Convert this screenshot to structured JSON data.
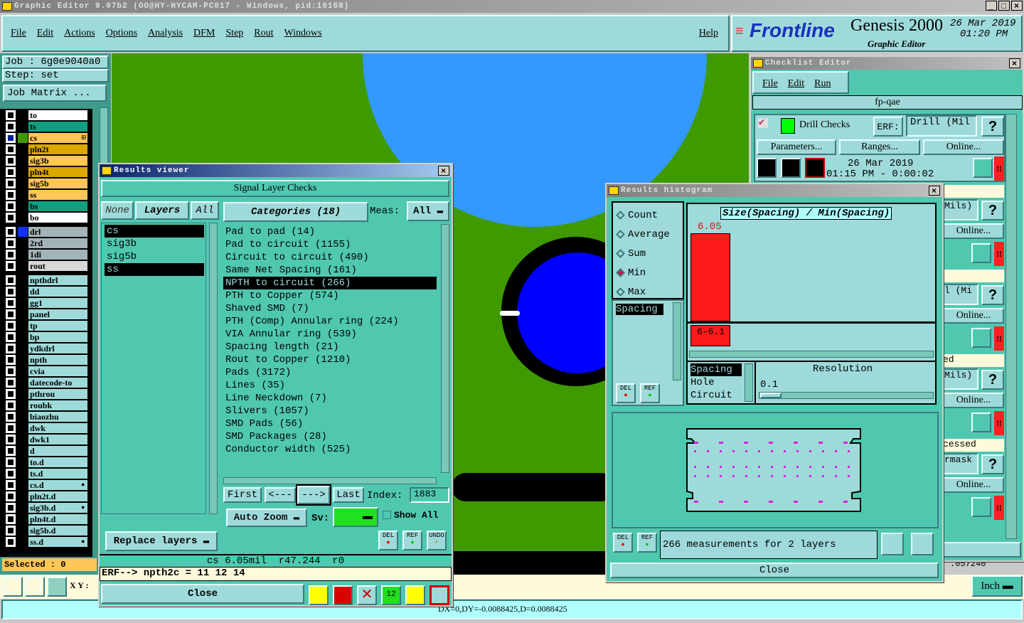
{
  "window_title": "Graphic Editor 9.07b2 (OO@HY-HYCAM-PC017 - Windows, pid:10168)",
  "menu": [
    "File",
    "Edit",
    "Actions",
    "Options",
    "Analysis",
    "DFM",
    "Step",
    "Rout",
    "Windows"
  ],
  "help": "Help",
  "brand": {
    "logo": "Frontline",
    "product": "Genesis 2000",
    "subtitle": "Graphic Editor",
    "date": "26 Mar 2019",
    "time": "01:20 PM"
  },
  "job": {
    "job_label": "Job : 6g0e9040a0",
    "step_label": "Step: set",
    "matrix_button": "Job Matrix ..."
  },
  "layers": [
    {
      "name": "to",
      "color": "#ffffff"
    },
    {
      "name": "ts",
      "color": "#10a080"
    },
    {
      "name": "cs",
      "color": "#ffc658",
      "active": true
    },
    {
      "name": "pln2t",
      "color": "#dba800"
    },
    {
      "name": "sig3b",
      "color": "#ffc658"
    },
    {
      "name": "pln4t",
      "color": "#dba800"
    },
    {
      "name": "sig5b",
      "color": "#ffc658"
    },
    {
      "name": "ss",
      "color": "#ffc658"
    },
    {
      "name": "bs",
      "color": "#10a080"
    },
    {
      "name": "bo",
      "color": "#ffffff"
    },
    {
      "name": "drl",
      "color": "#a3b4b8",
      "group": 2
    },
    {
      "name": "2rd",
      "color": "#a3b4b8",
      "group": 2
    },
    {
      "name": "1di",
      "color": "#a3b4b8",
      "group": 2
    },
    {
      "name": "rout",
      "color": "#d8d8d8",
      "group": 2
    },
    {
      "name": "npthdrl",
      "group": 3
    },
    {
      "name": "dd",
      "group": 3
    },
    {
      "name": "gg1",
      "group": 3
    },
    {
      "name": "panel",
      "group": 3
    },
    {
      "name": "tp",
      "group": 3
    },
    {
      "name": "bp",
      "group": 3
    },
    {
      "name": "ydkdrl",
      "group": 3
    },
    {
      "name": "npth",
      "group": 3
    },
    {
      "name": "cvia",
      "group": 3
    },
    {
      "name": "datecode-to",
      "group": 3
    },
    {
      "name": "pthrou",
      "group": 3
    },
    {
      "name": "roubk",
      "group": 3
    },
    {
      "name": "biaozhu",
      "group": 3
    },
    {
      "name": "dwk",
      "group": 3
    },
    {
      "name": "dwk1",
      "group": 3
    },
    {
      "name": "d",
      "group": 3
    },
    {
      "name": "to.d",
      "group": 3
    },
    {
      "name": "ts.d",
      "group": 3
    },
    {
      "name": "cs.d",
      "group": 3,
      "mark": true
    },
    {
      "name": "pln2t.d",
      "group": 3
    },
    {
      "name": "sig3b.d",
      "group": 3,
      "mark": true
    },
    {
      "name": "pln4t.d",
      "group": 3
    },
    {
      "name": "sig5b.d",
      "group": 3
    },
    {
      "name": "ss.d",
      "group": 3,
      "mark": true
    }
  ],
  "selected_label": "Selected : 0",
  "xy_label": "X Y :",
  "status_line": "DX=0,DY=-0.0088425,D=0.0088425",
  "units": "Inch",
  "coord_readout": ".057240",
  "results_viewer": {
    "title": "Results viewer",
    "header": "Signal Layer Checks",
    "none": "None",
    "layers_label": "Layers",
    "all": "All",
    "layers": [
      {
        "name": "cs",
        "selected": true
      },
      {
        "name": "sig3b"
      },
      {
        "name": "sig5b"
      },
      {
        "name": "ss",
        "selected": true
      }
    ],
    "categories_label": "Categories (18)",
    "meas_label": "Meas:",
    "meas_value": "All",
    "categories": [
      {
        "t": "Pad to pad (14)"
      },
      {
        "t": "Pad to circuit (1155)"
      },
      {
        "t": "Circuit to circuit (490)"
      },
      {
        "t": "Same Net Spacing (161)"
      },
      {
        "t": "NPTH to circuit (266)",
        "selected": true
      },
      {
        "t": "PTH to Copper (574)"
      },
      {
        "t": "Shaved SMD (7)"
      },
      {
        "t": "PTH (Comp) Annular ring (224)"
      },
      {
        "t": "VIA Annular ring (539)"
      },
      {
        "t": "Spacing length (21)"
      },
      {
        "t": "Rout to Copper (1210)"
      },
      {
        "t": "Pads (3172)"
      },
      {
        "t": "Lines (35)"
      },
      {
        "t": "Line Neckdown (7)"
      },
      {
        "t": "Slivers (1057)"
      },
      {
        "t": "SMD Pads (56)"
      },
      {
        "t": "SMD Packages (28)"
      },
      {
        "t": "Conductor width (525)"
      }
    ],
    "first": "First",
    "prev": "<---",
    "next": "--->",
    "last": "Last",
    "index_label": "Index:",
    "index_value": "1883",
    "auto_zoom": "Auto Zoom",
    "sv_label": "Sv:",
    "show_all": "Show All",
    "replace_layers": "Replace layers",
    "del": "DEL",
    "ref": "REF",
    "undo": "UNDO",
    "info": "cs 6.05mil  r47.244  r0",
    "erf": "ERF--> npth2c = 11 12 14",
    "close": "Close"
  },
  "histogram": {
    "title": "Results histogram",
    "modes": [
      {
        "label": "Count"
      },
      {
        "label": "Average"
      },
      {
        "label": "Sum"
      },
      {
        "label": "Min",
        "selected": true
      },
      {
        "label": "Max"
      }
    ],
    "measure_list": [
      "Spacing"
    ],
    "chart_title": "Size(Spacing) / Min(Spacing)",
    "bar_value": "6.05",
    "bar_range": "6-6.1",
    "bar_color": "#ff1a1a",
    "type_list": [
      {
        "t": "Spacing",
        "selected": true
      },
      {
        "t": "Hole"
      },
      {
        "t": "Circuit"
      }
    ],
    "resolution_label": "Resolution",
    "resolution_value": "0.1",
    "del": "DEL",
    "ref": "REF",
    "summary": "266 measurements for 2 layers",
    "close": "Close"
  },
  "checklist": {
    "title": "Checklist Editor",
    "menu": [
      "File",
      "Edit",
      "Run"
    ],
    "name": "fp-qae",
    "check_name": "Drill Checks",
    "erf_label": "ERF:",
    "erf_value": "Drill (Mil",
    "parameters": "Parameters...",
    "ranges": "Ranges...",
    "online": "Online...",
    "run_date": "26 Mar 2019",
    "run_time": "01:15 PM - 0:00:02",
    "help": "?",
    "alert": "!!",
    "rows": [
      {
        "erf": "Mils)"
      },
      {
        "erf": "l (Mi"
      },
      {
        "erf": "Mils)",
        "status": "ed"
      },
      {
        "erf": "rmask",
        "status": "cessed"
      }
    ]
  }
}
